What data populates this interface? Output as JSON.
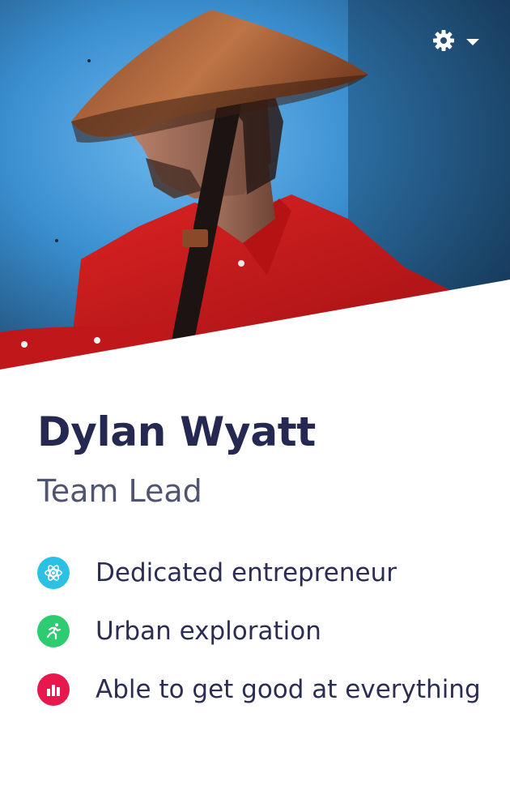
{
  "profile": {
    "name": "Dylan Wyatt",
    "role": "Team Lead"
  },
  "header": {
    "photo_subject": "man-in-conical-hat-and-red-shirt",
    "settings_icon": "gear-icon",
    "dropdown_icon": "caret-down-icon"
  },
  "traits": [
    {
      "label": "Dedicated entrepreneur",
      "icon": "atom-icon",
      "color": "#2bc0e4"
    },
    {
      "label": "Urban exploration",
      "icon": "running-icon",
      "color": "#2ecc71"
    },
    {
      "label": "Able to get good at everything",
      "icon": "bar-chart-icon",
      "color": "#e8174d"
    }
  ],
  "colors": {
    "title": "#252850",
    "subtitle": "#4f5470",
    "body": "#2b2d52",
    "photo_background": "#3a8fd0",
    "shirt": "#d01a1a",
    "hat": "#b6683e"
  }
}
